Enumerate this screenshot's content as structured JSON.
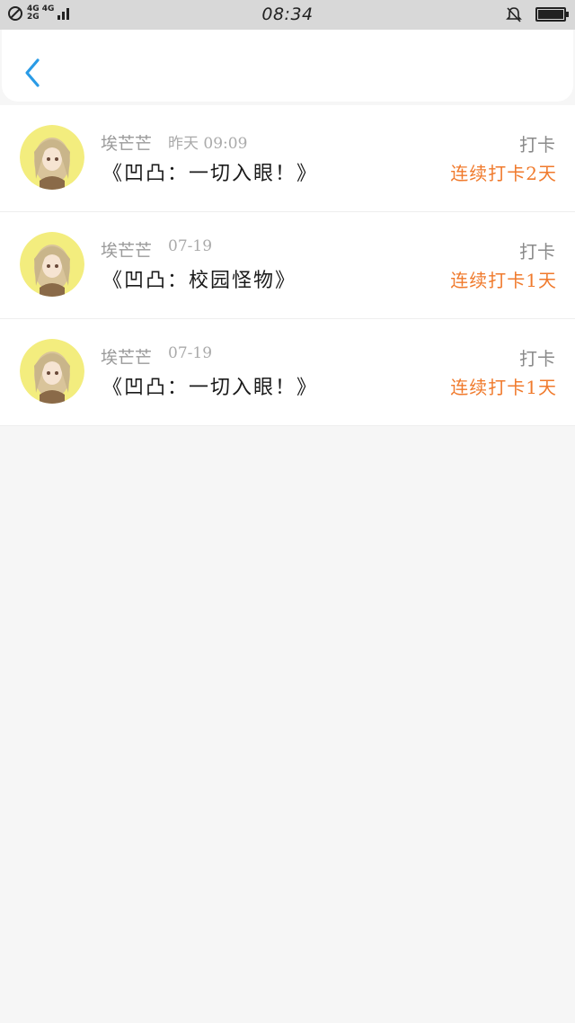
{
  "status_bar": {
    "network_top": "4G 4G",
    "network_bottom": "2G",
    "time": "08:34"
  },
  "header": {
    "back_icon": "chevron-left-icon",
    "accent_color": "#2a9be6"
  },
  "records": [
    {
      "user": "埃芒芒",
      "time": "昨天 09:09",
      "title": "《凹凸：一切入眼！》",
      "action": "打卡",
      "streak": "连续打卡2天"
    },
    {
      "user": "埃芒芒",
      "time": "07-19",
      "title": "《凹凸：校园怪物》",
      "action": "打卡",
      "streak": "连续打卡1天"
    },
    {
      "user": "埃芒芒",
      "time": "07-19",
      "title": "《凹凸：一切入眼！》",
      "action": "打卡",
      "streak": "连续打卡1天"
    }
  ],
  "colors": {
    "streak": "#f07a2c",
    "background": "#f6f6f6"
  }
}
